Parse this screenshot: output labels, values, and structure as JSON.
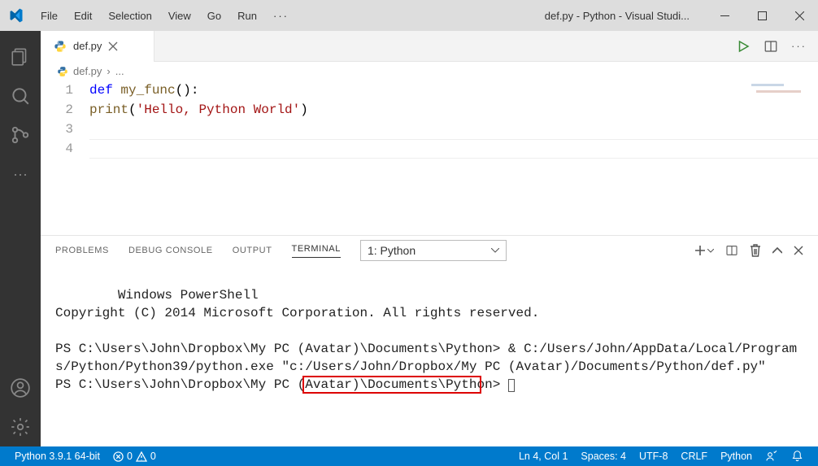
{
  "title_bar": {
    "menu": [
      "File",
      "Edit",
      "Selection",
      "View",
      "Go",
      "Run"
    ],
    "overflow": "···",
    "window_title": "def.py - Python - Visual Studi..."
  },
  "activity_bar": {
    "items": [
      "explorer-icon",
      "search-icon",
      "source-control-icon",
      "more-icon",
      "accounts-icon",
      "settings-icon"
    ]
  },
  "tabs": {
    "open": {
      "icon": "python-file-icon",
      "name": "def.py"
    },
    "actions": [
      "run-icon",
      "split-editor-icon",
      "more-icon"
    ]
  },
  "breadcrumb": {
    "file": "def.py",
    "sep": "›",
    "rest": "..."
  },
  "editor": {
    "lines": [
      {
        "num": "1",
        "tokens": [
          {
            "t": "def ",
            "c": "kw"
          },
          {
            "t": "my_func",
            "c": "fn"
          },
          {
            "t": "():",
            "c": ""
          }
        ]
      },
      {
        "num": "2",
        "tokens": [
          {
            "t": "    ",
            "c": ""
          },
          {
            "t": "print",
            "c": "fn"
          },
          {
            "t": "(",
            "c": ""
          },
          {
            "t": "'Hello, Python World'",
            "c": "str"
          },
          {
            "t": ")",
            "c": ""
          }
        ]
      },
      {
        "num": "3",
        "tokens": []
      },
      {
        "num": "4",
        "tokens": []
      }
    ],
    "cursor_line_index": 3
  },
  "panel": {
    "tabs": [
      "PROBLEMS",
      "DEBUG CONSOLE",
      "OUTPUT",
      "TERMINAL"
    ],
    "active_tab_index": 3,
    "terminal_selector": "1: Python",
    "terminal_icons": [
      "new-terminal-icon",
      "chevron-down-icon",
      "split-terminal-icon",
      "kill-terminal-icon",
      "collapse-panel-icon",
      "close-panel-icon"
    ],
    "terminal_text": "Windows PowerShell\nCopyright (C) 2014 Microsoft Corporation. All rights reserved.\n\nPS C:\\Users\\John\\Dropbox\\My PC (Avatar)\\Documents\\Python> & C:/Users/John/AppData/Local/Programs/Python/Python39/python.exe \"c:/Users/John/Dropbox/My PC (Avatar)/Documents/Python/def.py\"\nPS C:\\Users\\John\\Dropbox\\My PC (Avatar)\\Documents\\Python> "
  },
  "status_bar": {
    "python_version": "Python 3.9.1 64-bit",
    "errors": "0",
    "warnings": "0",
    "cursor": "Ln 4, Col 1",
    "spaces": "Spaces: 4",
    "encoding": "UTF-8",
    "eol": "CRLF",
    "language": "Python"
  }
}
